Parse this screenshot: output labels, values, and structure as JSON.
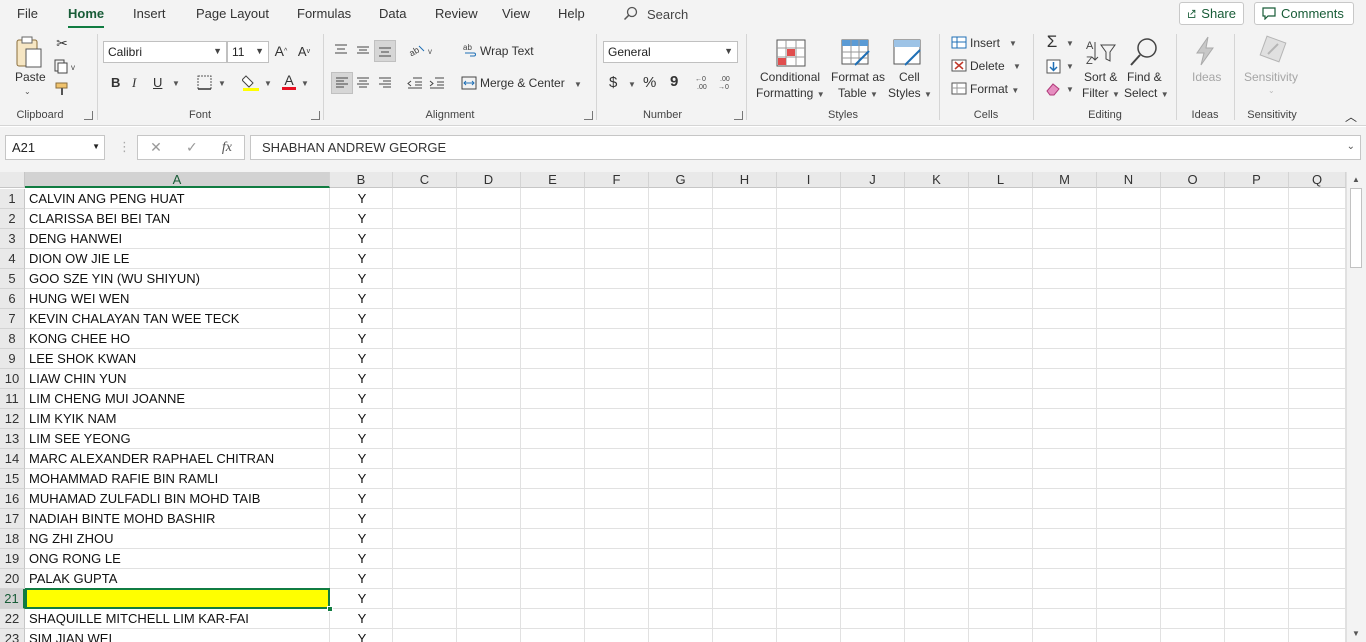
{
  "menu": {
    "tabs": [
      "File",
      "Home",
      "Insert",
      "Page Layout",
      "Formulas",
      "Data",
      "Review",
      "View",
      "Help"
    ],
    "active": "Home",
    "search": "Search",
    "share": "Share",
    "comments": "Comments"
  },
  "ribbon": {
    "clipboard": {
      "paste": "Paste",
      "label": "Clipboard"
    },
    "font": {
      "name": "Calibri",
      "size": "11",
      "bold": "B",
      "italic": "I",
      "underline": "U",
      "label": "Font"
    },
    "alignment": {
      "wrap": "Wrap Text",
      "merge": "Merge & Center",
      "label": "Alignment"
    },
    "number": {
      "format": "General",
      "currency": "$",
      "percent": "%",
      "comma": "9",
      "label": "Number"
    },
    "styles": {
      "cond1": "Conditional",
      "cond2": "Formatting",
      "fmt1": "Format as",
      "fmt2": "Table",
      "cell1": "Cell",
      "cell2": "Styles",
      "label": "Styles"
    },
    "cells": {
      "insert": "Insert",
      "delete": "Delete",
      "format": "Format",
      "label": "Cells"
    },
    "editing": {
      "sort1": "Sort &",
      "sort2": "Filter",
      "find1": "Find &",
      "find2": "Select",
      "label": "Editing"
    },
    "ideas": {
      "btn": "Ideas",
      "label": "Ideas"
    },
    "sensitivity": {
      "btn": "Sensitivity",
      "label": "Sensitivity"
    }
  },
  "formula_bar": {
    "name_box": "A21",
    "fx": "fx",
    "content": "SHABHAN ANDREW GEORGE"
  },
  "sheet": {
    "columns": [
      "A",
      "B",
      "C",
      "D",
      "E",
      "F",
      "G",
      "H",
      "I",
      "J",
      "K",
      "L",
      "M",
      "N",
      "O",
      "P",
      "Q"
    ],
    "selected_cell": "A21",
    "highlight_color": "#ffff00",
    "rows": [
      {
        "n": "1",
        "a": "CALVIN ANG PENG HUAT",
        "b": "Y"
      },
      {
        "n": "2",
        "a": "CLARISSA BEI BEI TAN",
        "b": "Y"
      },
      {
        "n": "3",
        "a": "DENG HANWEI",
        "b": "Y"
      },
      {
        "n": "4",
        "a": "DION OW JIE LE",
        "b": "Y"
      },
      {
        "n": "5",
        "a": "GOO SZE YIN (WU SHIYUN)",
        "b": "Y"
      },
      {
        "n": "6",
        "a": "HUNG WEI WEN",
        "b": "Y"
      },
      {
        "n": "7",
        "a": "KEVIN CHALAYAN TAN WEE TECK",
        "b": "Y"
      },
      {
        "n": "8",
        "a": "KONG CHEE HO",
        "b": "Y"
      },
      {
        "n": "9",
        "a": "LEE SHOK KWAN",
        "b": "Y"
      },
      {
        "n": "10",
        "a": "LIAW CHIN YUN",
        "b": "Y"
      },
      {
        "n": "11",
        "a": "LIM CHENG MUI JOANNE",
        "b": "Y"
      },
      {
        "n": "12",
        "a": "LIM KYIK NAM",
        "b": "Y"
      },
      {
        "n": "13",
        "a": "LIM SEE YEONG",
        "b": "Y"
      },
      {
        "n": "14",
        "a": "MARC ALEXANDER RAPHAEL CHITRAN",
        "b": "Y"
      },
      {
        "n": "15",
        "a": "MOHAMMAD RAFIE BIN RAMLI",
        "b": "Y"
      },
      {
        "n": "16",
        "a": "MUHAMAD ZULFADLI BIN MOHD TAIB",
        "b": "Y"
      },
      {
        "n": "17",
        "a": "NADIAH BINTE MOHD BASHIR",
        "b": "Y"
      },
      {
        "n": "18",
        "a": "NG ZHI ZHOU",
        "b": "Y"
      },
      {
        "n": "19",
        "a": "ONG RONG LE",
        "b": "Y"
      },
      {
        "n": "20",
        "a": "PALAK GUPTA",
        "b": "Y"
      },
      {
        "n": "21",
        "a": "SHABHAN ANDREW GEORGE",
        "b": "Y"
      },
      {
        "n": "22",
        "a": "SHAQUILLE MITCHELL LIM KAR-FAI",
        "b": "Y"
      },
      {
        "n": "23",
        "a": "SIM JIAN WEI",
        "b": "Y"
      }
    ]
  }
}
